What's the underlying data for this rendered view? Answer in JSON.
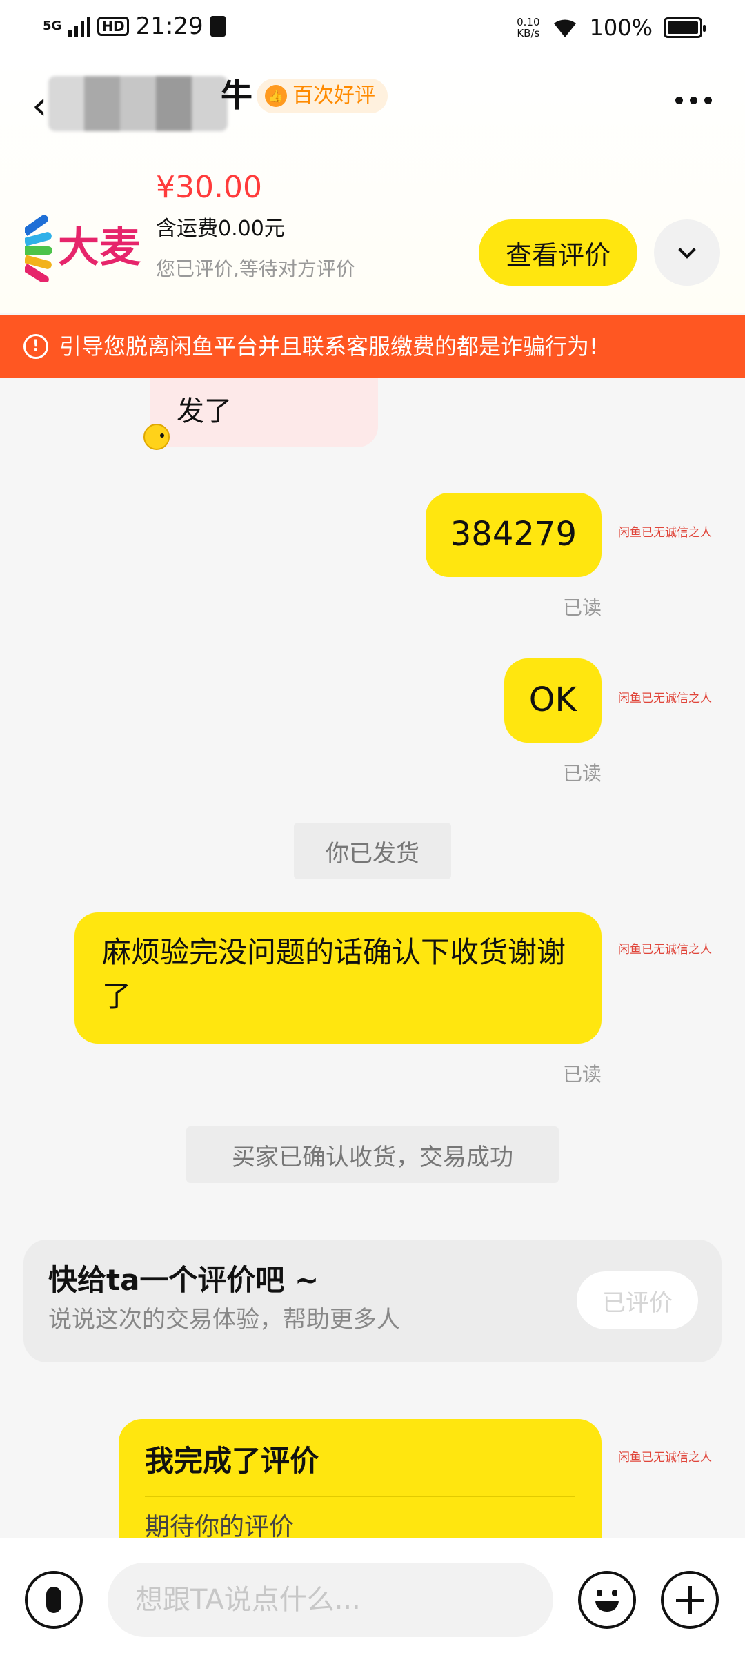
{
  "status_bar": {
    "network": "5G",
    "hd": "HD",
    "time": "21:29",
    "speed_value": "0.10",
    "speed_unit": "KB/s",
    "battery": "100%"
  },
  "header": {
    "user_name_suffix": "牛",
    "badge_label": "百次好评"
  },
  "item": {
    "logo_text": "大麦",
    "price": "¥30.00",
    "shipping": "含运费0.00元",
    "status": "您已评价,等待对方评价",
    "view_review_label": "查看评价"
  },
  "warning": {
    "text": "引导您脱离闲鱼平台并且联系客服缴费的都是诈骗行为!"
  },
  "chat": {
    "partial_message": "发了",
    "watermark": "闲鱼已无诚信之人",
    "messages": [
      {
        "text": "384279",
        "read": "已读"
      },
      {
        "text": "OK",
        "read": "已读"
      },
      {
        "text": "麻烦验完没问题的话确认下收货谢谢了",
        "read": "已读"
      }
    ],
    "system_shipped": "你已发货",
    "system_confirmed": "买家已确认收货，交易成功",
    "rate_card": {
      "title": "快给ta一个评价吧 ~",
      "subtitle": "说说这次的交易体验，帮助更多人",
      "button": "已评价"
    },
    "done_card": {
      "title": "我完成了评价",
      "subtitle": "期待你的评价"
    }
  },
  "input": {
    "placeholder": "想跟TA说点什么..."
  },
  "colors": {
    "accent_yellow": "#ffe60f",
    "warning_orange": "#ff5722",
    "price_red": "#ff3b3b"
  }
}
